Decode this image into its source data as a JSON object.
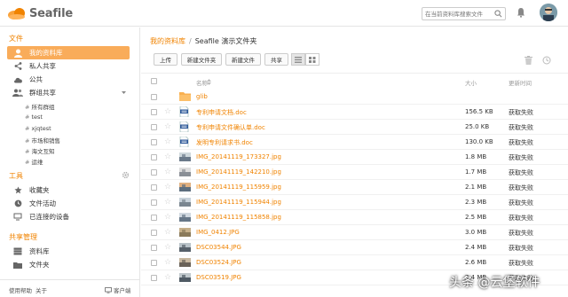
{
  "header": {
    "logo_text": "Seafile",
    "search_placeholder": "在当前资料库搜索文件"
  },
  "sidebar": {
    "files_heading": "文件",
    "items": [
      {
        "label": "我的资料库",
        "icon": "user-icon"
      },
      {
        "label": "私人共享",
        "icon": "share-icon"
      },
      {
        "label": "公共",
        "icon": "cloud-icon"
      },
      {
        "label": "群组共享",
        "icon": "group-icon"
      }
    ],
    "groups": [
      "所有群组",
      "test",
      "xjqtest",
      "市场和销售",
      "海文互知",
      "运维"
    ],
    "tools_heading": "工具",
    "tools": [
      {
        "label": "收藏夹",
        "icon": "star-icon"
      },
      {
        "label": "文件活动",
        "icon": "clock-icon"
      },
      {
        "label": "已连接的设备",
        "icon": "monitor-icon"
      }
    ],
    "admin_heading": "共享管理",
    "admin": [
      {
        "label": "资料库",
        "icon": "library-icon"
      },
      {
        "label": "文件夹",
        "icon": "folder-icon"
      }
    ],
    "footer": {
      "help": "使用帮助",
      "about": "关于",
      "client": "客户端"
    }
  },
  "main": {
    "breadcrumb": {
      "root": "我的资料库",
      "sep": "/",
      "current": "Seafile 演示文件夹"
    },
    "toolbar": {
      "upload": "上传",
      "new_folder": "新建文件夹",
      "new_file": "新建文件",
      "share": "共享"
    },
    "columns": {
      "name": "名称",
      "size": "大小",
      "modified": "更新时间"
    },
    "files": [
      {
        "name": "glib",
        "size": "",
        "modified": "",
        "type": "folder"
      },
      {
        "name": "专利申请文档.doc",
        "size": "156.5 KB",
        "modified": "获取失败",
        "type": "doc"
      },
      {
        "name": "专利申请文件确认单.doc",
        "size": "25.0 KB",
        "modified": "获取失败",
        "type": "doc"
      },
      {
        "name": "发明专利请求书.doc",
        "size": "130.0 KB",
        "modified": "获取失败",
        "type": "doc"
      },
      {
        "name": "IMG_20141119_173327.jpg",
        "size": "1.8 MB",
        "modified": "获取失败",
        "type": "img"
      },
      {
        "name": "IMG_20141119_142210.jpg",
        "size": "1.7 MB",
        "modified": "获取失败",
        "type": "img"
      },
      {
        "name": "IMG_20141119_115959.jpg",
        "size": "2.1 MB",
        "modified": "获取失败",
        "type": "img"
      },
      {
        "name": "IMG_20141119_115944.jpg",
        "size": "2.3 MB",
        "modified": "获取失败",
        "type": "img"
      },
      {
        "name": "IMG_20141119_115858.jpg",
        "size": "2.5 MB",
        "modified": "获取失败",
        "type": "img"
      },
      {
        "name": "IMG_0412.JPG",
        "size": "3.0 MB",
        "modified": "获取失败",
        "type": "img"
      },
      {
        "name": "DSC03544.JPG",
        "size": "2.4 MB",
        "modified": "获取失败",
        "type": "img"
      },
      {
        "name": "DSC03524.JPG",
        "size": "2.6 MB",
        "modified": "获取失败",
        "type": "img"
      },
      {
        "name": "DSC03519.JPG",
        "size": "2.4 MB",
        "modified": "获取失败",
        "type": "img"
      }
    ]
  },
  "watermark": "头条 @云堡软件",
  "colors": {
    "accent": "#f08300",
    "active_bg": "#f9ac5a"
  }
}
